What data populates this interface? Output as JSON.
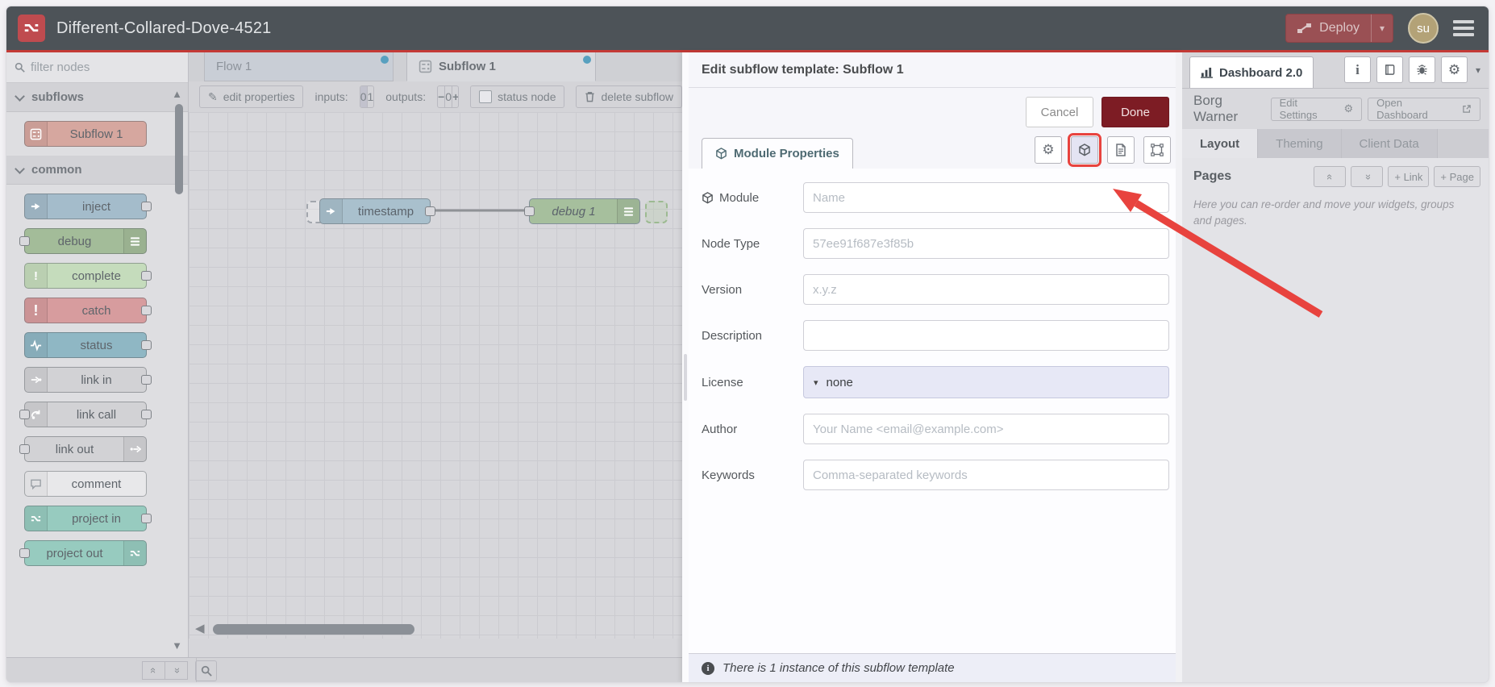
{
  "window": {
    "title": "Different-Collared-Dove-4521"
  },
  "header": {
    "deploy_label": "Deploy",
    "avatar_initials": "su"
  },
  "palette": {
    "filter_placeholder": "filter nodes",
    "sections": [
      {
        "label": "subflows",
        "items": [
          {
            "label": "Subflow 1"
          }
        ]
      },
      {
        "label": "common",
        "items": [
          {
            "label": "inject"
          },
          {
            "label": "debug"
          },
          {
            "label": "complete"
          },
          {
            "label": "catch"
          },
          {
            "label": "status"
          },
          {
            "label": "link in"
          },
          {
            "label": "link call"
          },
          {
            "label": "link out"
          },
          {
            "label": "comment"
          },
          {
            "label": "project in"
          },
          {
            "label": "project out"
          }
        ]
      }
    ]
  },
  "tabs": [
    {
      "label": "Flow 1"
    },
    {
      "label": "Subflow 1"
    }
  ],
  "toolbar": {
    "edit_properties": "edit properties",
    "inputs_label": "inputs:",
    "inputs_options": [
      "0",
      "1"
    ],
    "outputs_label": "outputs:",
    "outputs_minus": "−",
    "outputs_value": "0",
    "outputs_plus": "+",
    "status_node": "status node",
    "delete_label": "delete subflow"
  },
  "canvas": {
    "nodes": [
      {
        "label": "timestamp"
      },
      {
        "label": "debug 1"
      }
    ]
  },
  "tray": {
    "title": "Edit subflow template: Subflow 1",
    "cancel": "Cancel",
    "done": "Done",
    "tab": "Module Properties",
    "fields": [
      {
        "label": "Module",
        "placeholder": "Name"
      },
      {
        "label": "Node Type",
        "placeholder": "57ee91f687e3f85b"
      },
      {
        "label": "Version",
        "placeholder": "x.y.z"
      },
      {
        "label": "Description",
        "placeholder": ""
      },
      {
        "label": "License",
        "value": "none"
      },
      {
        "label": "Author",
        "placeholder": "Your Name <email@example.com>"
      },
      {
        "label": "Keywords",
        "placeholder": "Comma-separated keywords"
      }
    ],
    "footer": "There is 1 instance of this subflow template"
  },
  "sidebar": {
    "tab": "Dashboard 2.0",
    "project": "Borg Warner",
    "edit_settings": "Edit Settings",
    "open_dashboard": "Open Dashboard",
    "tabs": [
      "Layout",
      "Theming",
      "Client Data"
    ],
    "pages_title": "Pages",
    "link_button": "+ Link",
    "page_button": "+ Page",
    "hint": "Here you can re-order and move your widgets, groups and pages."
  },
  "icons": {
    "edit": "✎",
    "caret_down": "▾",
    "gear": "⚙",
    "tri_up": "▲",
    "tri_down": "▼",
    "tri_left": "◀",
    "chevrons": "«",
    "info_i": "i"
  },
  "colors": {
    "annotation": "#e8433e",
    "blue_dot": "#58a0bf",
    "done_red": "#7d1c24",
    "header": "#4d5358"
  }
}
